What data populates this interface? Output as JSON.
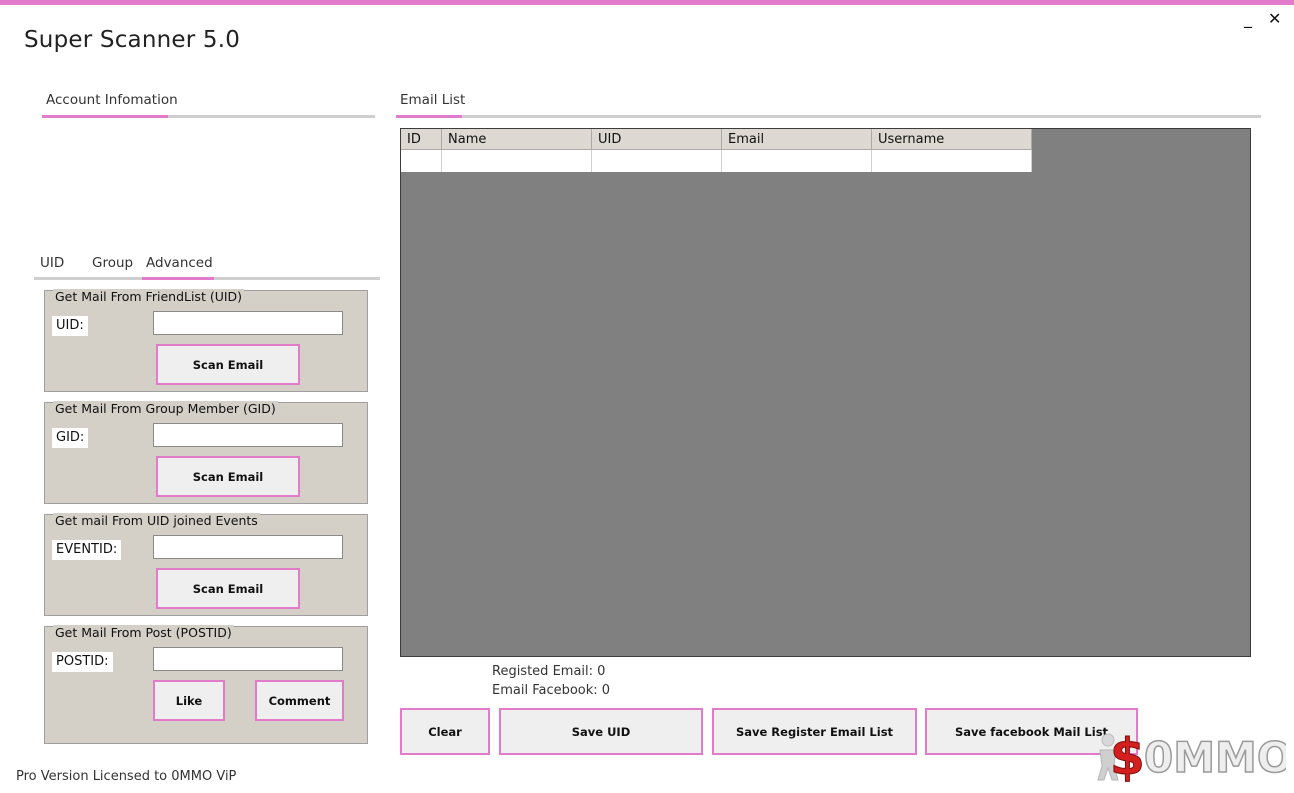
{
  "app": {
    "title": "Super Scanner 5.0",
    "minimize": "_",
    "close": "✕"
  },
  "account_tab": {
    "label": "Account Infomation"
  },
  "left_tabs": [
    "UID",
    "Group",
    "Advanced"
  ],
  "sections": [
    {
      "legend": "Get Mail From FriendList (UID)",
      "label": "UID:",
      "value": "",
      "buttons": [
        "Scan Email"
      ]
    },
    {
      "legend": "Get Mail From Group Member (GID)",
      "label": "GID:",
      "value": "",
      "buttons": [
        "Scan Email"
      ]
    },
    {
      "legend": "Get mail From UID joined Events",
      "label": "EVENTID:",
      "value": "",
      "buttons": [
        "Scan Email"
      ]
    },
    {
      "legend": "Get Mail From Post (POSTID)",
      "label": "POSTID:",
      "value": "",
      "buttons": [
        "Like",
        "Comment"
      ]
    }
  ],
  "email_tab": {
    "label": "Email List"
  },
  "grid": {
    "columns": [
      "ID",
      "Name",
      "UID",
      "Email",
      "Username"
    ],
    "rows": [
      [
        "",
        "",
        "",
        "",
        ""
      ]
    ]
  },
  "stats": {
    "registed": "Registed Email: 0",
    "facebook": "Email Facebook: 0"
  },
  "actions": [
    "Clear",
    "Save UID",
    "Save Register Email List",
    "Save facebook Mail List"
  ],
  "footer": "Pro Version Licensed to 0MMO ViP",
  "watermark": "$0MMO",
  "colors": {
    "accent": "#e27bc9",
    "panel": "#d4d0c8",
    "grid_bg": "#808080"
  }
}
